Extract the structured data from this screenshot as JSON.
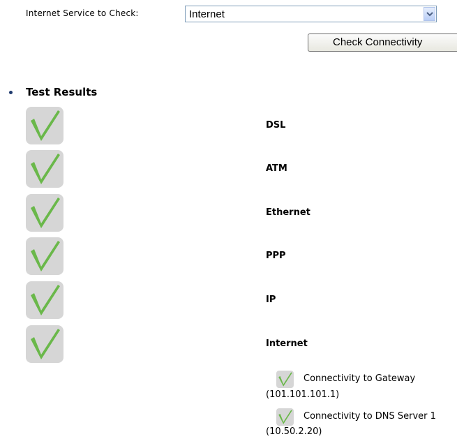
{
  "service": {
    "label": "Internet Service to Check:",
    "selected": "Internet"
  },
  "check_button": "Check Connectivity",
  "results": {
    "title": "Test Results",
    "tests": [
      {
        "label": "DSL",
        "status": "pass"
      },
      {
        "label": "ATM",
        "status": "pass"
      },
      {
        "label": "Ethernet",
        "status": "pass"
      },
      {
        "label": "PPP",
        "status": "pass"
      },
      {
        "label": "IP",
        "status": "pass"
      },
      {
        "label": "Internet",
        "status": "pass"
      }
    ],
    "sub_tests": [
      {
        "label": "Connectivity to Gateway",
        "value": "(101.101.101.1)",
        "status": "pass"
      },
      {
        "label": "Connectivity to DNS Server 1",
        "value": "(10.50.2.20)",
        "status": "pass"
      }
    ]
  },
  "colors": {
    "check_green": "#6ab84a",
    "tile_gray": "#d6d6d6",
    "bullet": "#1f3a6e"
  },
  "icons": {
    "pass": "checkmark-icon",
    "dropdown": "chevron-down-icon"
  }
}
